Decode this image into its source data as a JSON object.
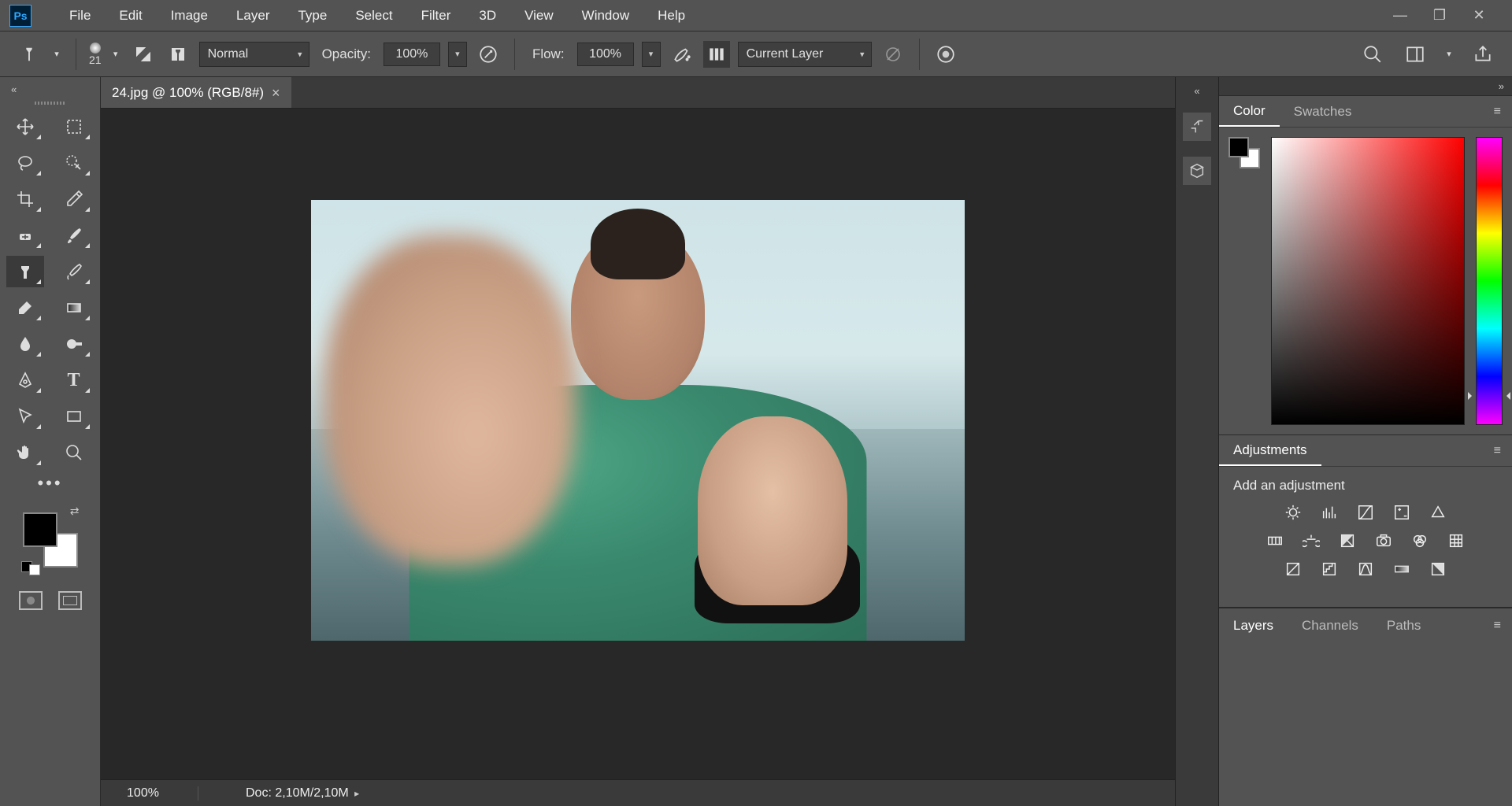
{
  "menu": {
    "items": [
      "File",
      "Edit",
      "Image",
      "Layer",
      "Type",
      "Select",
      "Filter",
      "3D",
      "View",
      "Window",
      "Help"
    ]
  },
  "options": {
    "brush_size": "21",
    "blend_mode": "Normal",
    "opacity_label": "Opacity:",
    "opacity_value": "100%",
    "flow_label": "Flow:",
    "flow_value": "100%",
    "sample_mode": "Current Layer"
  },
  "document": {
    "tab_title": "24.jpg @ 100% (RGB/8#)",
    "zoom": "100%",
    "doc_info": "Doc: 2,10M/2,10M"
  },
  "panels": {
    "color_tab": "Color",
    "swatches_tab": "Swatches",
    "adjustments_tab": "Adjustments",
    "adjustments_hint": "Add an adjustment",
    "layers_tab": "Layers",
    "channels_tab": "Channels",
    "paths_tab": "Paths"
  }
}
